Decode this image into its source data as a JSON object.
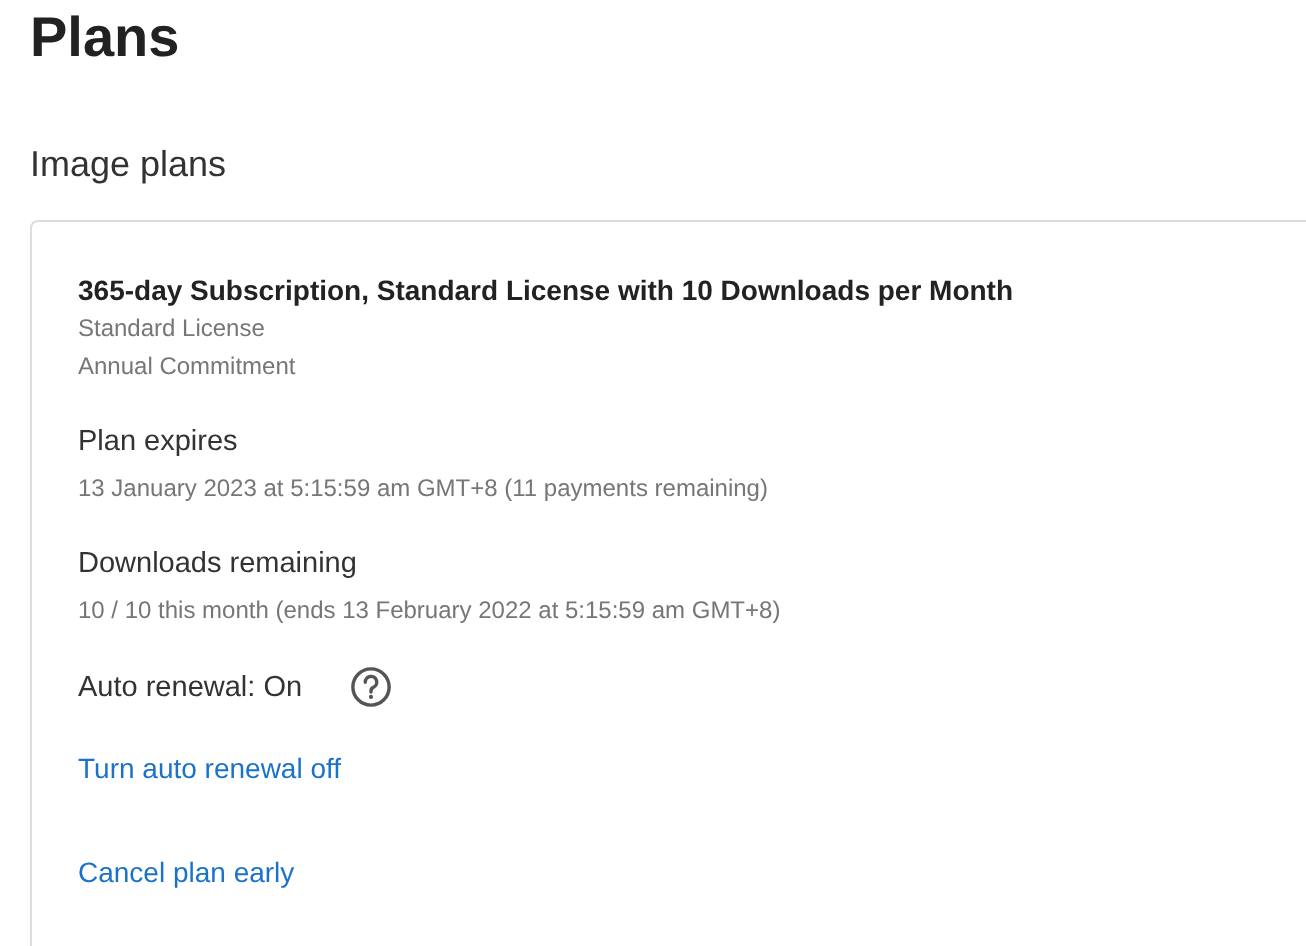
{
  "page_title": "Plans",
  "section_title": "Image plans",
  "plan": {
    "name": "365-day Subscription, Standard License with 10 Downloads per Month",
    "details": [
      "Standard License",
      "Annual Commitment"
    ],
    "fields": [
      {
        "label": "Plan expires",
        "value": "13 January 2023 at 5:15:59 am GMT+8 (11 payments remaining)"
      },
      {
        "label": "Downloads remaining",
        "value": "10 / 10 this month (ends 13 February 2022 at 5:15:59 am GMT+8)"
      }
    ],
    "auto_renewal": {
      "label": "Auto renewal: On",
      "on": true
    },
    "links": [
      "Turn auto renewal off",
      "Cancel plan early"
    ]
  }
}
